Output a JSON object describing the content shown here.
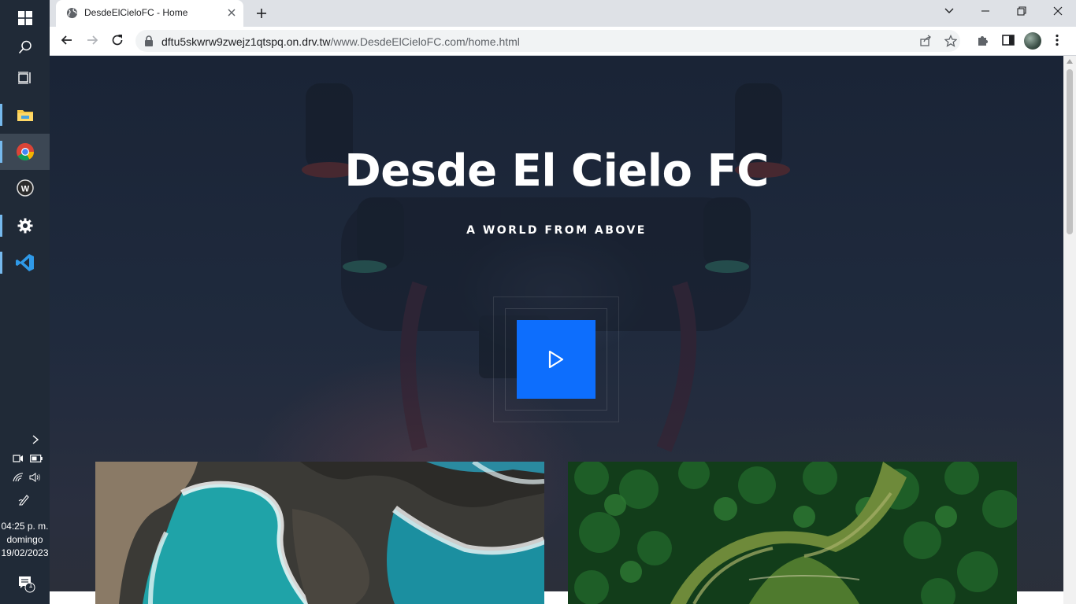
{
  "taskbar": {
    "apps": [
      {
        "name": "start",
        "icon": "windows-icon"
      },
      {
        "name": "search",
        "icon": "search-icon"
      },
      {
        "name": "task-view",
        "icon": "task-view-icon"
      },
      {
        "name": "file-explorer",
        "icon": "folder-icon"
      },
      {
        "name": "chrome",
        "icon": "chrome-icon"
      },
      {
        "name": "wamp",
        "icon": "wamp-icon"
      },
      {
        "name": "settings",
        "icon": "gear-icon"
      },
      {
        "name": "vscode",
        "icon": "vscode-icon"
      }
    ],
    "clock": {
      "time": "04:25 p. m.",
      "day": "domingo",
      "date": "19/02/2023"
    },
    "notifications_count": "1"
  },
  "browser": {
    "tab_title": "DesdeElCieloFC - Home",
    "url_host": "dftu5skwrw9zwejz1qtspq.on.drv.tw",
    "url_path": "/www.DesdeElCieloFC.com/home.html"
  },
  "page": {
    "hero_title": "Desde El Cielo FC",
    "hero_subtitle": "A WORLD FROM ABOVE",
    "play_button_color": "#0d6efd"
  },
  "colors": {
    "taskbar_bg": "#202a37",
    "tabstrip_bg": "#dee1e6",
    "hero_overlay": "#1c2535",
    "accent": "#0d6efd"
  }
}
